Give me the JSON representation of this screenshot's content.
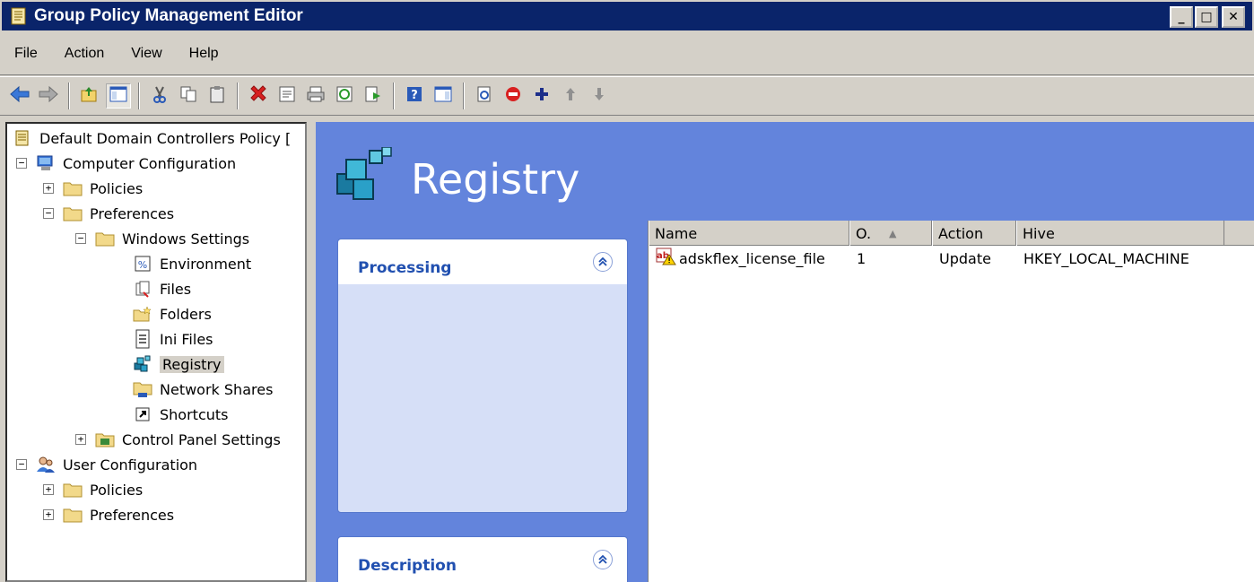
{
  "window": {
    "title": "Group Policy Management Editor",
    "minimize": "_",
    "maximize": "□",
    "close": "✕"
  },
  "menu": {
    "items": [
      "File",
      "Action",
      "View",
      "Help"
    ]
  },
  "toolbar": {
    "icons": [
      "back-icon",
      "forward-icon",
      "up-folder-icon",
      "show-hide-tree-icon",
      "cut-icon",
      "copy-icon",
      "paste-icon",
      "delete-icon",
      "properties-icon",
      "print-icon",
      "refresh-icon",
      "export-list-icon",
      "help-icon",
      "show-hide-action-pane-icon",
      "new-item-preview-icon",
      "stop-icon",
      "add-icon",
      "move-up-icon",
      "move-down-icon"
    ]
  },
  "tree": {
    "nodes": [
      {
        "label": "Default Domain Controllers Policy [",
        "icon": "policy-document-icon"
      },
      {
        "label": "Computer Configuration",
        "icon": "computer-icon",
        "exp": "−"
      },
      {
        "label": "Policies",
        "icon": "folder-icon",
        "exp": "+"
      },
      {
        "label": "Preferences",
        "icon": "folder-icon",
        "exp": "−"
      },
      {
        "label": "Windows Settings",
        "icon": "folder-icon",
        "exp": "−"
      },
      {
        "label": "Environment",
        "icon": "environment-icon"
      },
      {
        "label": "Files",
        "icon": "files-icon"
      },
      {
        "label": "Folders",
        "icon": "folders-icon"
      },
      {
        "label": "Ini Files",
        "icon": "ini-files-icon"
      },
      {
        "label": "Registry",
        "icon": "registry-icon",
        "selected": true
      },
      {
        "label": "Network Shares",
        "icon": "network-shares-icon"
      },
      {
        "label": "Shortcuts",
        "icon": "shortcuts-icon"
      },
      {
        "label": "Control Panel Settings",
        "icon": "control-panel-icon",
        "exp": "+"
      },
      {
        "label": "User Configuration",
        "icon": "user-icon",
        "exp": "−"
      },
      {
        "label": "Policies",
        "icon": "folder-icon",
        "exp": "+"
      },
      {
        "label": "Preferences",
        "icon": "folder-icon",
        "exp": "+"
      }
    ]
  },
  "content": {
    "heading": "Registry",
    "processing_panel": {
      "title": "Processing"
    },
    "description_panel": {
      "title": "Description"
    }
  },
  "listview": {
    "columns": [
      "Name",
      "O.",
      "Action",
      "Hive"
    ],
    "sort_indicator": "▲",
    "rows": [
      {
        "name": "adskflex_license_file",
        "order": "1",
        "action": "Update",
        "hive": "HKEY_LOCAL_MACHINE"
      }
    ]
  },
  "colors": {
    "titlebar": "#0a246a",
    "content_bg": "#6384dc",
    "panel_title": "#2150b0",
    "chrome": "#d4d0c8"
  }
}
